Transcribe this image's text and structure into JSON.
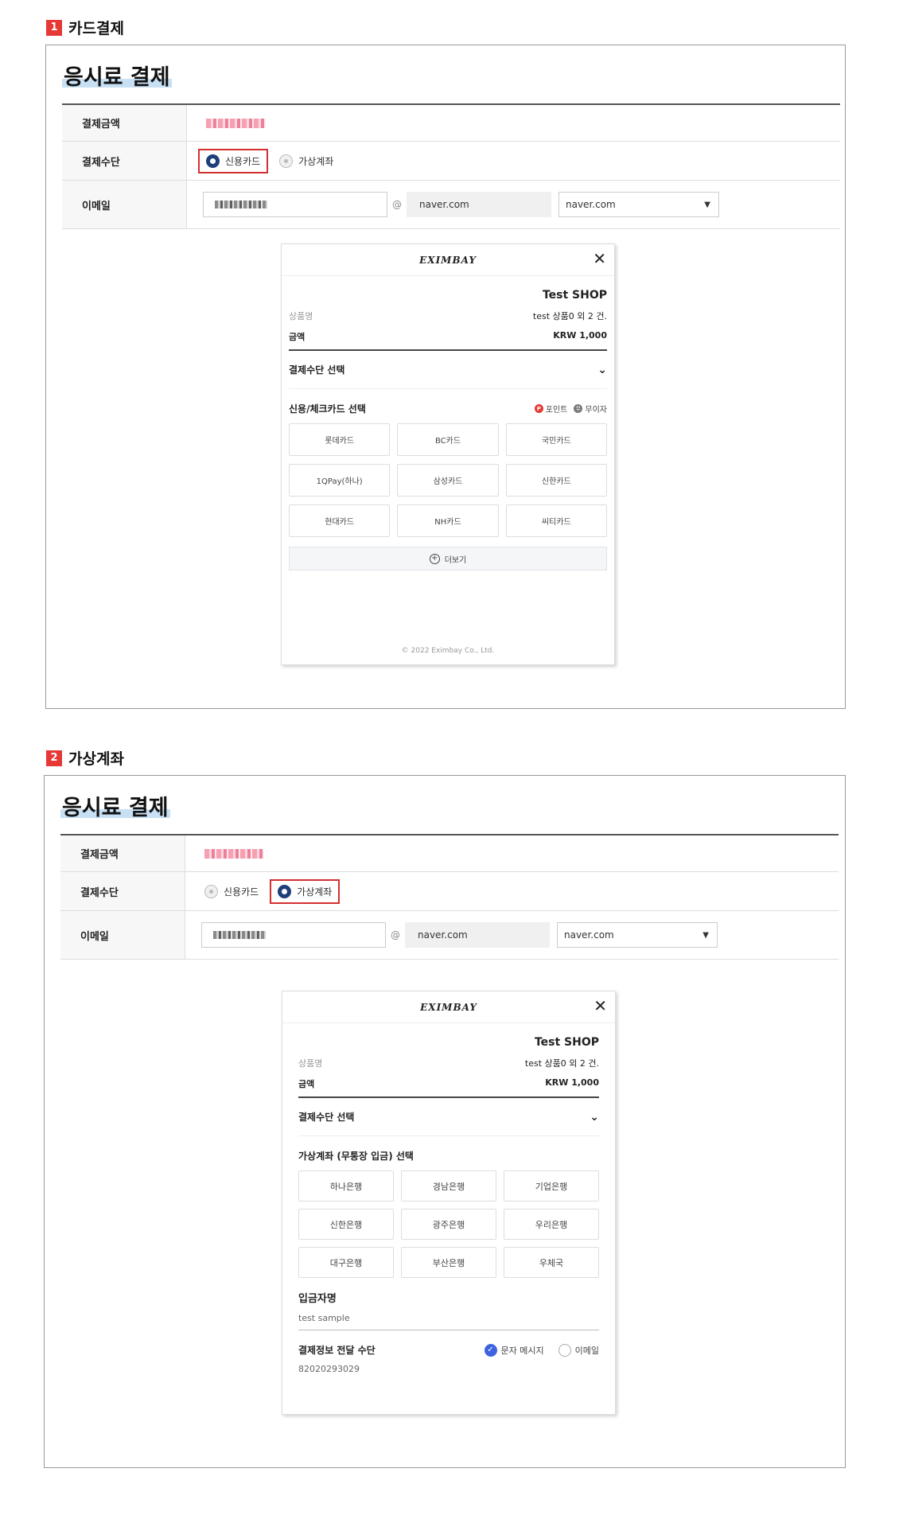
{
  "section1": {
    "num": "1",
    "title": "카드결제",
    "fee_title": "응시료 결제",
    "rows": {
      "amount": "결제금액",
      "method": "결제수단",
      "email": "이메일"
    },
    "radio": {
      "card": "신용카드",
      "vaccount": "가상계좌",
      "selected": "card"
    },
    "email": {
      "at": "@",
      "domain": "naver.com",
      "select_value": "naver.com"
    },
    "modal": {
      "logo": "EXIMBAY",
      "close": "✕",
      "shop": "Test SHOP",
      "product_label": "상품명",
      "product_value": "test 상품0 외 2 건.",
      "amount_label": "금액",
      "amount_value": "KRW 1,000",
      "method_select": "결제수단 선택",
      "card_select": "신용/체크카드 선택",
      "badge_point": "포인트",
      "badge_free": "무이자",
      "cards": [
        "롯데카드",
        "BC카드",
        "국민카드",
        "1QPay(하나)",
        "삼성카드",
        "신한카드",
        "현대카드",
        "NH카드",
        "씨티카드"
      ],
      "more": "더보기",
      "copyright": "© 2022 Eximbay Co., Ltd."
    }
  },
  "section2": {
    "num": "2",
    "title": "가상계좌",
    "fee_title": "응시료 결제",
    "rows": {
      "amount": "결제금액",
      "method": "결제수단",
      "email": "이메일"
    },
    "radio": {
      "card": "신용카드",
      "vaccount": "가상계좌",
      "selected": "vaccount"
    },
    "email": {
      "at": "@",
      "domain": "naver.com",
      "select_value": "naver.com"
    },
    "modal": {
      "logo": "EXIMBAY",
      "close": "✕",
      "shop": "Test SHOP",
      "product_label": "상품명",
      "product_value": "test 상품0 외 2 건.",
      "amount_label": "금액",
      "amount_value": "KRW 1,000",
      "method_select": "결제수단 선택",
      "bank_select": "가상계좌 (무통장 입금) 선택",
      "banks": [
        "하나은행",
        "경남은행",
        "기업은행",
        "신한은행",
        "광주은행",
        "우리은행",
        "대구은행",
        "부산은행",
        "우체국"
      ],
      "depositor_label": "입금자명",
      "depositor_value": "test sample",
      "delivery_label": "결제정보 전달 수단",
      "delivery_sms": "문자 메시지",
      "delivery_email": "이메일",
      "phone": "82020293029"
    }
  },
  "colors": {
    "accent_red": "#e53935",
    "radio_on": "#1d3f7a",
    "check_blue": "#3f63e0"
  }
}
